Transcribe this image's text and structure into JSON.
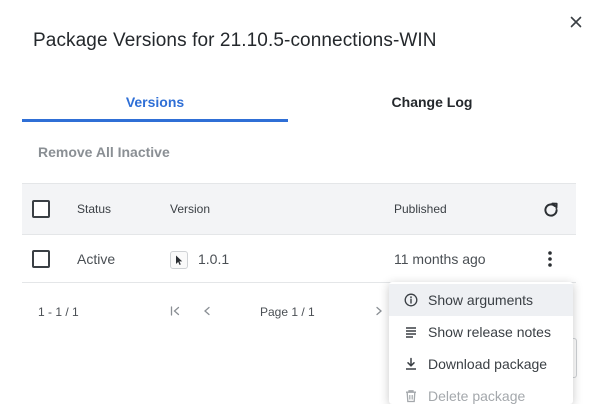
{
  "dialog": {
    "title": "Package Versions for 21.10.5-connections-WIN"
  },
  "tabs": [
    {
      "label": "Versions",
      "active": true
    },
    {
      "label": "Change Log",
      "active": false
    }
  ],
  "actions": {
    "remove_inactive_label": "Remove All Inactive"
  },
  "table": {
    "columns": [
      "Status",
      "Version",
      "Published"
    ],
    "rows": [
      {
        "status": "Active",
        "version": "1.0.1",
        "published": "11 months ago",
        "checked": false
      }
    ]
  },
  "pagination": {
    "range": "1 - 1 / 1",
    "page": "Page 1 / 1",
    "first_glyph": "|<",
    "prev_glyph": "<",
    "next_glyph": ">"
  },
  "context_menu": {
    "items": [
      {
        "label": "Show arguments",
        "icon": "info-icon",
        "hover": true,
        "disabled": false
      },
      {
        "label": "Show release notes",
        "icon": "notes-icon",
        "hover": false,
        "disabled": false
      },
      {
        "label": "Download package",
        "icon": "download-icon",
        "hover": false,
        "disabled": false
      },
      {
        "label": "Delete package",
        "icon": "trash-icon",
        "hover": false,
        "disabled": true
      }
    ]
  },
  "colors": {
    "accent": "#2f6fd6",
    "header_bg": "#f3f4f6",
    "muted_text": "#8a8f94"
  }
}
